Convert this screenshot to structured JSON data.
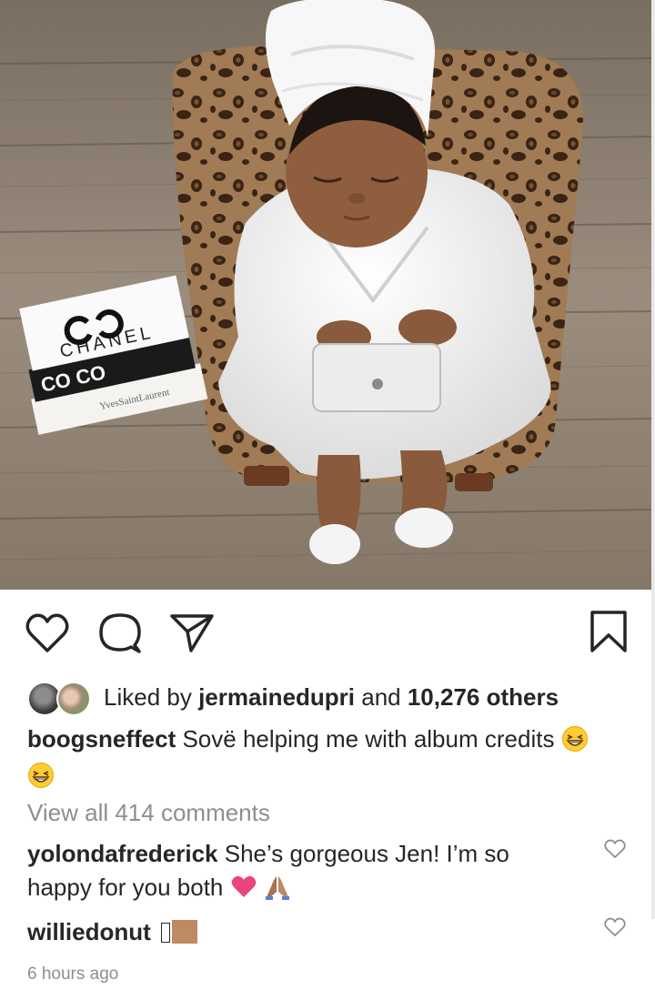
{
  "photo": {
    "alt": "Newborn in white robe and towel turban sleeping on a leopard print chair holding a toy phone, beside Chanel books"
  },
  "photo_text": {
    "book_brand": "CHANEL",
    "book_spine_1": "CO CO",
    "book_spine_2": "YvesSaintLaurent"
  },
  "actions": {
    "like_icon": "heart-outline-icon",
    "comment_icon": "speech-bubble-icon",
    "share_icon": "paper-plane-icon",
    "save_icon": "bookmark-icon"
  },
  "likes": {
    "prefix": "Liked by ",
    "user": "jermainedupri",
    "middle": " and ",
    "count": "10,276 others"
  },
  "caption": {
    "username": "boogsneffect",
    "text": " Sovë helping me with album credits "
  },
  "view_all": "View all 414 comments",
  "comments": [
    {
      "username": "yolondafrederick",
      "text": " She’s gorgeous Jen! I’m so happy for you both "
    },
    {
      "username": "williedonut",
      "text": " "
    }
  ],
  "timestamp": "6 hours ago",
  "colors": {
    "text": "#262626",
    "muted": "#8e8e8e",
    "heart_emoji": "#e8457c",
    "skin_tone": "#bd8a64"
  }
}
